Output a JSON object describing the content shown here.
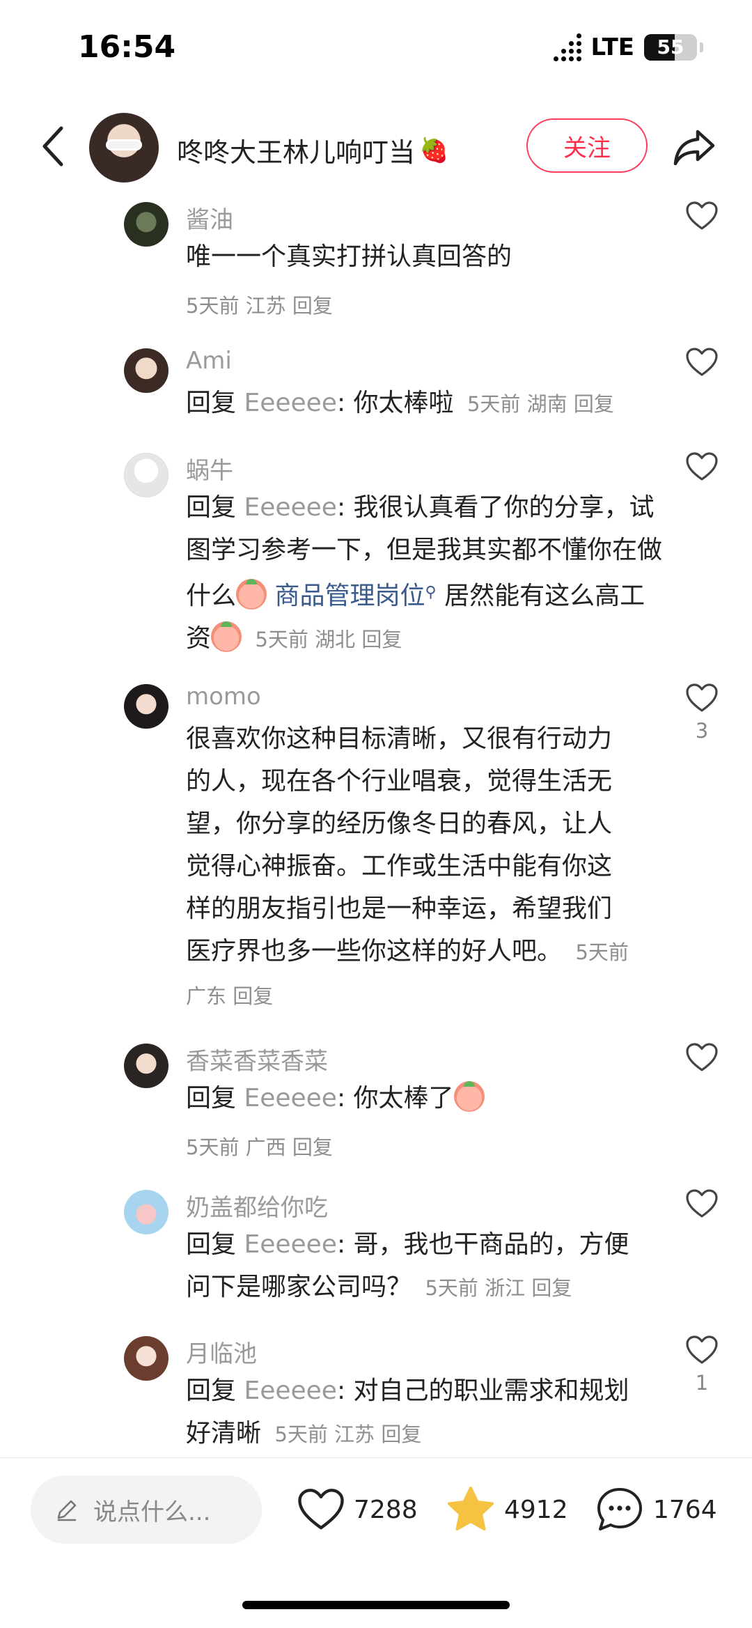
{
  "status_bar": {
    "time": "16:54",
    "network": "LTE",
    "battery": "55"
  },
  "header": {
    "title": "咚咚大王林儿响叮当",
    "title_emoji": "🍓",
    "follow_label": "关注"
  },
  "comments": [
    {
      "name": "酱油",
      "text": "唯一一个真实打拼认真回答的",
      "meta": "5天前 江苏 回复",
      "likes": ""
    },
    {
      "name": "Ami",
      "reply_prefix": "回复 ",
      "reply_to": "Eeeeee",
      "text": ": 你太棒啦",
      "meta": "5天前 湖南 回复",
      "likes": ""
    },
    {
      "name": "蜗牛",
      "reply_prefix": "回复 ",
      "reply_to": "Eeeeee",
      "text_part1": ": 我很认真看了你的分享，试图学习参考一下，但是我其实都不懂你在做什么",
      "link": "商品管理岗位",
      "text_part2": "居然能有这么高工资",
      "meta": "5天前 湖北 回复",
      "likes": ""
    },
    {
      "name": "momo",
      "text": "很喜欢你这种目标清晰，又很有行动力的人，现在各个行业唱衰，觉得生活无望，你分享的经历像冬日的春风，让人觉得心神振奋。工作或生活中能有你这样的朋友指引也是一种幸运，希望我们医疗界也多一些你这样的好人吧。",
      "meta": "5天前 广东 回复",
      "likes": "3"
    },
    {
      "name": "香菜香菜香菜",
      "reply_prefix": "回复 ",
      "reply_to": "Eeeeee",
      "text": ": 你太棒了",
      "meta": "5天前 广西 回复",
      "likes": ""
    },
    {
      "name": "奶盖都给你吃",
      "reply_prefix": "回复 ",
      "reply_to": "Eeeeee",
      "text": ": 哥，我也干商品的，方便问下是哪家公司吗？",
      "meta": "5天前 浙江 回复",
      "likes": ""
    },
    {
      "name": "月临池",
      "reply_prefix": "回复 ",
      "reply_to": "Eeeeee",
      "text": ": 对自己的职业需求和规划好清晰",
      "meta": "5天前 江苏 回复",
      "likes": "1"
    }
  ],
  "bottom_bar": {
    "input_placeholder": "说点什么...",
    "likes": "7288",
    "favorites": "4912",
    "comments": "1764"
  },
  "colors": {
    "accent": "#ff2e4d",
    "star": "#f5c242",
    "link": "#3a5a8c"
  }
}
